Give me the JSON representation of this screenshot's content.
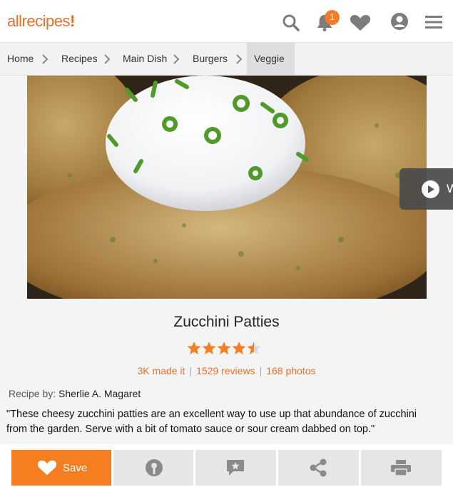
{
  "header": {
    "logo_text": "allrecipes",
    "logo_bang": "!",
    "notification_count": "1",
    "brand_color": "#e8702a",
    "icons": [
      "search-icon",
      "bell-icon",
      "heart-icon",
      "user-icon",
      "menu-icon"
    ]
  },
  "breadcrumb": [
    "Home",
    "Recipes",
    "Main Dish",
    "Burgers",
    "Veggie"
  ],
  "video_tab_label": "W",
  "recipe": {
    "title": "Zucchini Patties",
    "rating": 4.5,
    "made_it": "3K made it",
    "reviews": "1529 reviews",
    "photos": "168 photos",
    "recipe_by_label": "Recipe by:",
    "author": "Sherlie A. Magaret",
    "description_line1": "\"These cheesy zucchini patties are an excellent way to use up that abundance of zucchini",
    "description_line2": "from the garden. Serve with a bit of tomato sauce or sour cream dabbed on top.\""
  },
  "actions": {
    "save_label": "Save",
    "icons": [
      "heart-icon",
      "pin-icon",
      "review-icon",
      "share-icon",
      "print-icon"
    ]
  }
}
